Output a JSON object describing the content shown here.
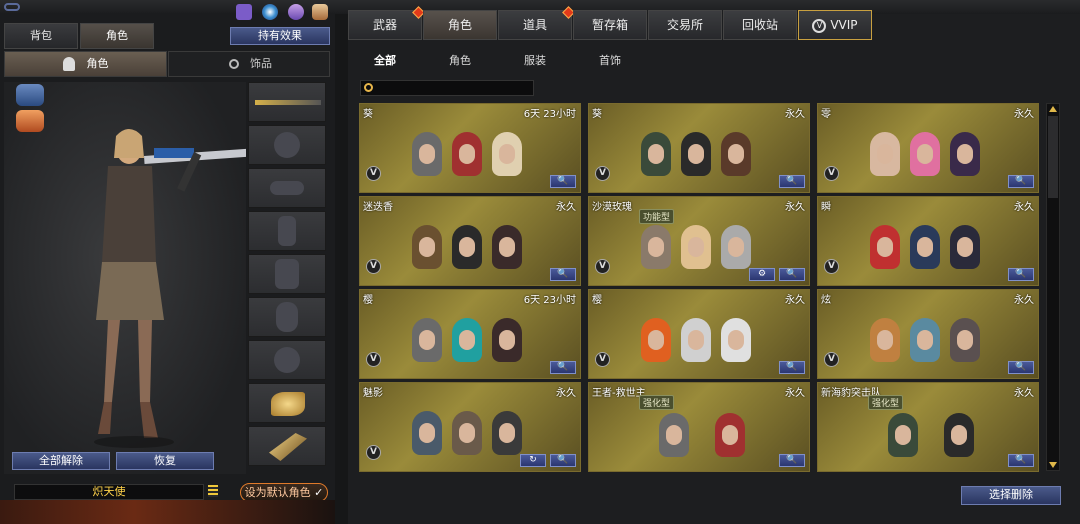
{
  "left_panel": {
    "tabs": [
      "背包",
      "角色"
    ],
    "active_tab": "角色",
    "equip_effect_button": "持有效果",
    "subtabs": [
      "角色",
      "饰品"
    ],
    "active_subtab": "角色",
    "unequip_all_button": "全部解除",
    "restore_button": "恢复",
    "character_name": "炽天使",
    "set_default_button": "设为默认角色"
  },
  "main_tabs": [
    {
      "label": "武器",
      "hot": true
    },
    {
      "label": "角色",
      "hot": false
    },
    {
      "label": "道具",
      "hot": true
    },
    {
      "label": "暂存箱",
      "hot": false
    },
    {
      "label": "交易所",
      "hot": false
    },
    {
      "label": "回收站",
      "hot": false
    },
    {
      "label": "VVIP",
      "hot": false
    }
  ],
  "active_main_tab": "角色",
  "category_tabs": [
    "全部",
    "角色",
    "服装",
    "首饰"
  ],
  "active_category_tab": "全部",
  "search": {
    "placeholder": ""
  },
  "cards": [
    {
      "name": "葵",
      "duration": "6天 23小时",
      "tag": "",
      "badge": "V"
    },
    {
      "name": "葵",
      "duration": "永久",
      "tag": "",
      "badge": "V"
    },
    {
      "name": "零",
      "duration": "永久",
      "tag": "",
      "badge": "V"
    },
    {
      "name": "迷迭香",
      "duration": "永久",
      "tag": "",
      "badge": "V"
    },
    {
      "name": "沙漠玫瑰",
      "duration": "永久",
      "tag": "功能型",
      "badge": "V"
    },
    {
      "name": "瞬",
      "duration": "永久",
      "tag": "",
      "badge": "V"
    },
    {
      "name": "樱",
      "duration": "6天 23小时",
      "tag": "",
      "badge": "V"
    },
    {
      "name": "樱",
      "duration": "永久",
      "tag": "",
      "badge": "V"
    },
    {
      "name": "炫",
      "duration": "永久",
      "tag": "",
      "badge": "V"
    },
    {
      "name": "魅影",
      "duration": "永久",
      "tag": "",
      "badge": "V"
    },
    {
      "name": "王者-救世主",
      "duration": "永久",
      "tag": "强化型",
      "badge": ""
    },
    {
      "name": "新海豹突击队",
      "duration": "永久",
      "tag": "强化型",
      "badge": ""
    }
  ],
  "select_delete_button": "选择删除",
  "colors": {
    "card_gold": "#9a8b3a",
    "button_blue": "#2b3670",
    "accent_orange": "#e07a2a"
  }
}
